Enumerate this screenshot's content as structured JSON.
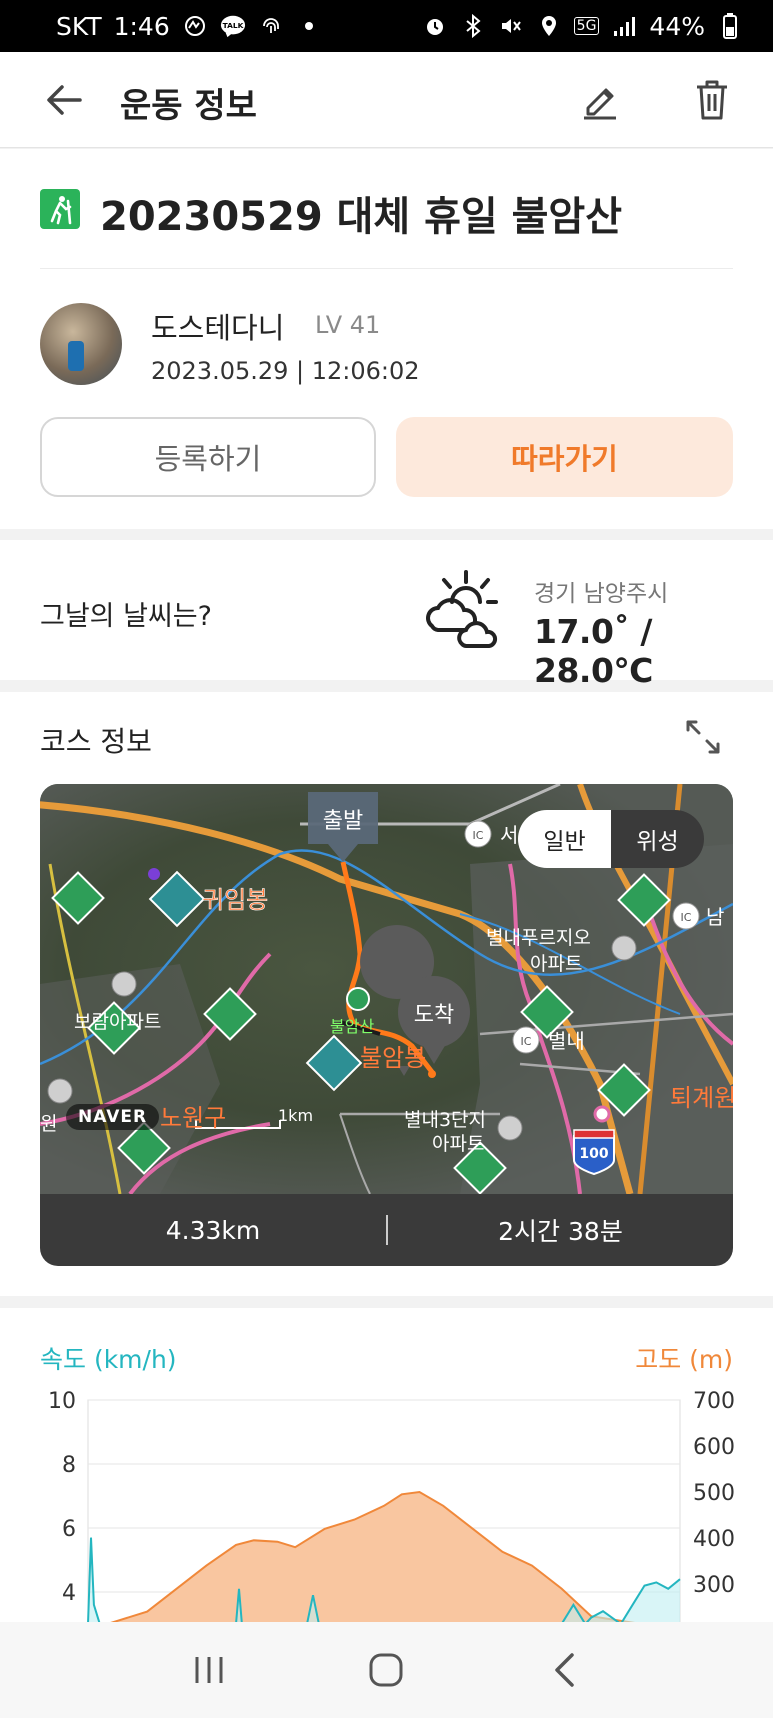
{
  "status": {
    "carrier": "SKT",
    "time": "1:46",
    "battery": "44%",
    "network": "5G",
    "icons": [
      "activity-icon",
      "talk-icon",
      "fingerprint-icon",
      "dot-icon",
      "alarm-icon",
      "bluetooth-icon",
      "mute-icon",
      "location-icon",
      "signal-icon",
      "battery-icon"
    ]
  },
  "header": {
    "title": "운동 정보",
    "icons": [
      "back-arrow-icon",
      "edit-pencil-icon",
      "trash-icon"
    ]
  },
  "exercise": {
    "title": "20230529 대체 휴일 불암산",
    "icon": "hiking-icon",
    "user": {
      "name": "도스테다니",
      "level": "LV 41",
      "datetime": "2023.05.29 | 12:06:02"
    },
    "register_label": "등록하기",
    "follow_label": "따라가기"
  },
  "weather": {
    "question": "그날의 날씨는?",
    "location": "경기 남양주시",
    "temp": "17.0˚ / 28.0℃",
    "icon": "partly-cloudy-icon"
  },
  "course": {
    "title": "코스 정보",
    "expand_icon": "expand-icon",
    "map": {
      "toggle_normal": "일반",
      "toggle_satellite": "위성",
      "start_label": "출발",
      "end_label": "도착",
      "naver": "NAVER",
      "scale": "1km",
      "places": {
        "gwiimbong": "귀임봉",
        "buram": "불암산",
        "buram_peak": "불암봉",
        "nowon": "노원구",
        "byeollae_prugio": "별내푸르지오",
        "apt1": "아파트",
        "byeollae": "별내",
        "byeollae3": "별내3단지",
        "apt2": "아파트",
        "toegye": "퇴계원",
        "bora_apt": "보람아파트",
        "won": "원",
        "seo": "서",
        "nam": "남",
        "ic": "IC",
        "hwy": "100"
      }
    },
    "distance": "4.33km",
    "duration": "2시간 38분"
  },
  "chart": {
    "speed_legend": "속도 (km/h)",
    "altitude_legend": "고도 (m)",
    "left_ticks": [
      "10",
      "8",
      "6",
      "4"
    ],
    "right_ticks": [
      "700",
      "600",
      "500",
      "400",
      "300"
    ],
    "colors": {
      "speed": "#24b6c0",
      "altitude": "#f0883a",
      "altitude_fill": "#f9c6a0"
    }
  },
  "chart_data": {
    "type": "area",
    "title": "",
    "xlabel": "",
    "ylabel_left": "속도 (km/h)",
    "ylabel_right": "고도 (m)",
    "ylim_left": [
      2,
      10
    ],
    "ylim_right": [
      200,
      700
    ],
    "grid": true,
    "series": [
      {
        "name": "고도 (m)",
        "axis": "right",
        "type": "area",
        "x": [
          0,
          0.1,
          0.15,
          0.2,
          0.25,
          0.28,
          0.32,
          0.35,
          0.4,
          0.45,
          0.5,
          0.53,
          0.56,
          0.6,
          0.65,
          0.7,
          0.75,
          0.8,
          0.85,
          1.0
        ],
        "values": [
          200,
          240,
          290,
          340,
          385,
          395,
          392,
          380,
          420,
          440,
          470,
          495,
          500,
          470,
          420,
          370,
          340,
          290,
          230,
          200
        ]
      },
      {
        "name": "속도 (km/h)",
        "axis": "left",
        "type": "line",
        "x": [
          0,
          0.005,
          0.01,
          0.02,
          0.25,
          0.255,
          0.26,
          0.37,
          0.38,
          0.39,
          0.8,
          0.82,
          0.84,
          0.85,
          0.87,
          0.9,
          0.92,
          0.94,
          0.96,
          0.98,
          1.0
        ],
        "values": [
          3,
          5.7,
          3.6,
          3,
          3,
          4.1,
          3,
          3,
          3.9,
          3,
          3,
          3.6,
          3,
          3.2,
          3.4,
          3,
          3.6,
          4.2,
          4.3,
          4.1,
          4.4
        ]
      }
    ]
  }
}
